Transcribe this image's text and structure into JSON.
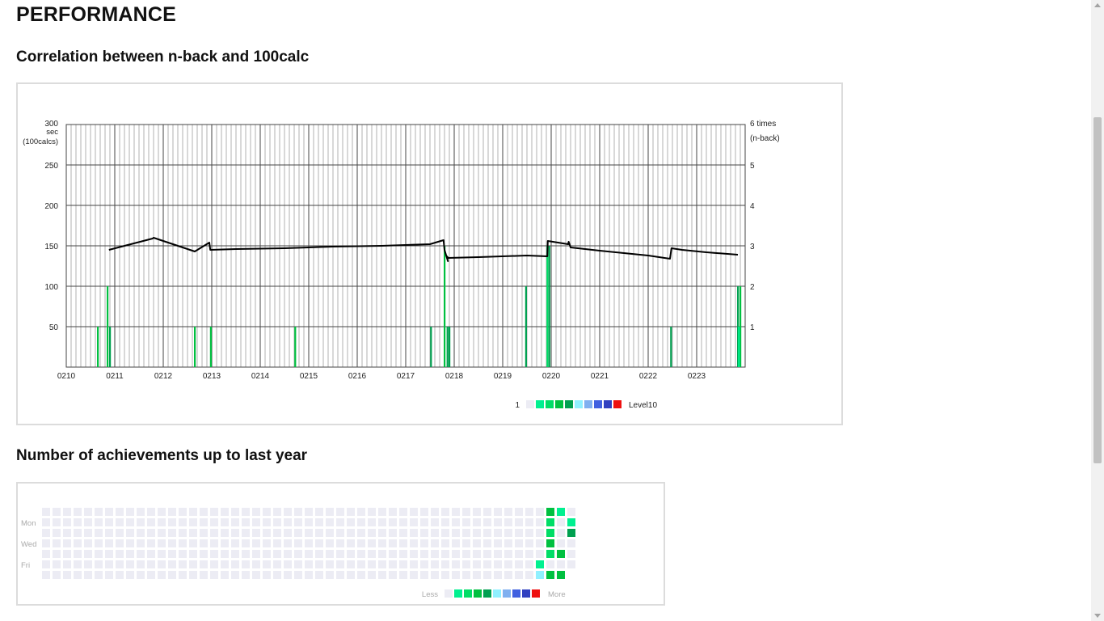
{
  "page": {
    "title": "PERFORMANCE",
    "section_correlation": "Correlation between n-back and 100calc",
    "section_achievements": "Number of achievements up to last year"
  },
  "colors": {
    "levels": [
      "#ececf4",
      "#00f090",
      "#00dd66",
      "#00c040",
      "#00a050",
      "#90f0ff",
      "#80b0f0",
      "#4060e0",
      "#3040c0",
      "#ee1010"
    ],
    "line": "#000000",
    "grid_major": "#444444",
    "grid_minor": "#b0b0b0"
  },
  "chart_data": {
    "type": "line",
    "left_axis": {
      "label_lines": [
        "300",
        "sec",
        "(100calcs)"
      ],
      "ticks": [
        50,
        100,
        150,
        200,
        250
      ],
      "range": [
        0,
        300
      ]
    },
    "right_axis": {
      "label_lines": [
        "6 times",
        "(n-back)"
      ],
      "ticks": [
        1,
        2,
        3,
        4,
        5
      ],
      "range": [
        0,
        6
      ]
    },
    "x_ticks": [
      "0210",
      "0211",
      "0212",
      "0213",
      "0214",
      "0215",
      "0216",
      "0217",
      "0218",
      "0219",
      "0220",
      "0221",
      "0222",
      "0223"
    ],
    "line_series": {
      "x": [
        10.88,
        11.78,
        11.8,
        12.65,
        12.95,
        12.97,
        13.5,
        14.5,
        15.5,
        16.5,
        17.5,
        17.78,
        17.8,
        17.87,
        17.85,
        17.88,
        18.5,
        19.5,
        19.92,
        19.93,
        20.35,
        20.36,
        20.4,
        21.0,
        21.5,
        22.0,
        22.45,
        22.48,
        22.7,
        23.2,
        23.85
      ],
      "y": [
        145,
        159,
        160,
        143,
        154,
        145,
        146,
        147,
        149,
        150,
        152,
        157,
        145,
        131,
        137,
        135,
        136,
        138,
        137,
        156,
        152,
        155,
        148,
        144,
        141,
        138,
        134,
        147,
        145,
        142,
        139
      ]
    },
    "bars": [
      {
        "x": 10.65,
        "value": 1,
        "level": 3
      },
      {
        "x": 10.85,
        "value": 2,
        "level": 3
      },
      {
        "x": 10.9,
        "value": 1,
        "level": 4
      },
      {
        "x": 12.65,
        "value": 1,
        "level": 3
      },
      {
        "x": 12.98,
        "value": 1,
        "level": 3
      },
      {
        "x": 14.72,
        "value": 1,
        "level": 3
      },
      {
        "x": 17.52,
        "value": 1,
        "level": 4
      },
      {
        "x": 17.8,
        "value": 3,
        "level": 3
      },
      {
        "x": 17.86,
        "value": 1,
        "level": 4
      },
      {
        "x": 17.9,
        "value": 1,
        "level": 4
      },
      {
        "x": 19.48,
        "value": 2,
        "level": 4
      },
      {
        "x": 19.92,
        "value": 3,
        "level": 2
      },
      {
        "x": 19.96,
        "value": 3,
        "level": 4
      },
      {
        "x": 22.47,
        "value": 1,
        "level": 4
      },
      {
        "x": 23.85,
        "value": 2,
        "level": 4
      },
      {
        "x": 23.9,
        "value": 2,
        "level": 3
      },
      {
        "x": 23.87,
        "value": 1,
        "level": 1
      }
    ],
    "legend": {
      "start": "1",
      "end": "Level10"
    }
  },
  "achievements": {
    "type": "heatmap",
    "day_labels": [
      "Mon",
      "Wed",
      "Fri"
    ],
    "legend_less": "Less",
    "legend_more": "More",
    "weeks": 51,
    "last_week_days": 6,
    "cells": [
      {
        "week": 47,
        "day": 5,
        "level": 1
      },
      {
        "week": 47,
        "day": 6,
        "level": 5
      },
      {
        "week": 48,
        "day": 0,
        "level": 3
      },
      {
        "week": 48,
        "day": 1,
        "level": 2
      },
      {
        "week": 48,
        "day": 2,
        "level": 2
      },
      {
        "week": 48,
        "day": 3,
        "level": 3
      },
      {
        "week": 48,
        "day": 4,
        "level": 2
      },
      {
        "week": 48,
        "day": 6,
        "level": 3
      },
      {
        "week": 49,
        "day": 0,
        "level": 1
      },
      {
        "week": 49,
        "day": 4,
        "level": 3
      },
      {
        "week": 49,
        "day": 6,
        "level": 3
      },
      {
        "week": 50,
        "day": 1,
        "level": 1
      },
      {
        "week": 50,
        "day": 2,
        "level": 4
      }
    ]
  }
}
